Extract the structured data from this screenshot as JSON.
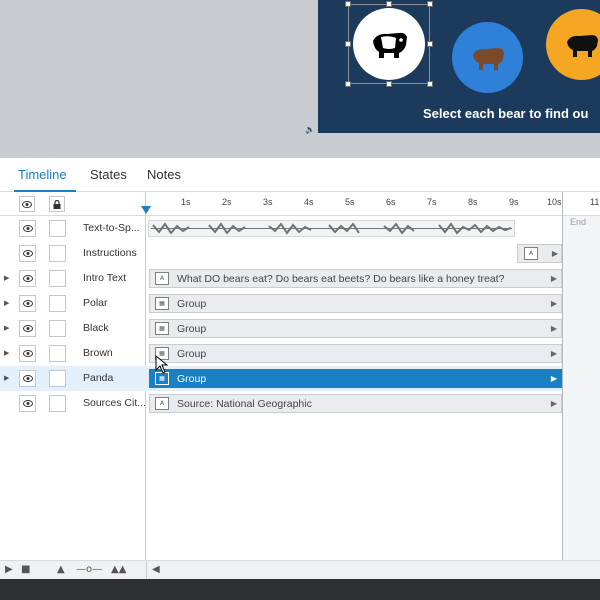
{
  "stage": {
    "slide_text": "Select each bear to find ou",
    "colors": {
      "slide_bg": "#1b3a5c",
      "bear_blue": "#2f80d8",
      "bear_orange": "#f5a623",
      "accent": "#1a80c4"
    }
  },
  "tabs": {
    "timeline": "Timeline",
    "states": "States",
    "notes": "Notes"
  },
  "ruler": {
    "ticks": [
      "1s",
      "2s",
      "3s",
      "4s",
      "5s",
      "6s",
      "7s",
      "8s",
      "9s",
      "10s",
      "11"
    ],
    "end_label": "End"
  },
  "rows": [
    {
      "label": "Text-to-Sp..."
    },
    {
      "label": "Instructions"
    },
    {
      "label": "Intro Text",
      "bar": "What DO bears eat? Do bears eat beets? Do bears like a honey treat?"
    },
    {
      "label": "Polar",
      "bar": "Group"
    },
    {
      "label": "Black",
      "bar": "Group"
    },
    {
      "label": "Brown",
      "bar": "Group"
    },
    {
      "label": "Panda",
      "bar": "Group"
    },
    {
      "label": "Sources Cit...",
      "bar": "Source: National Geographic"
    }
  ]
}
